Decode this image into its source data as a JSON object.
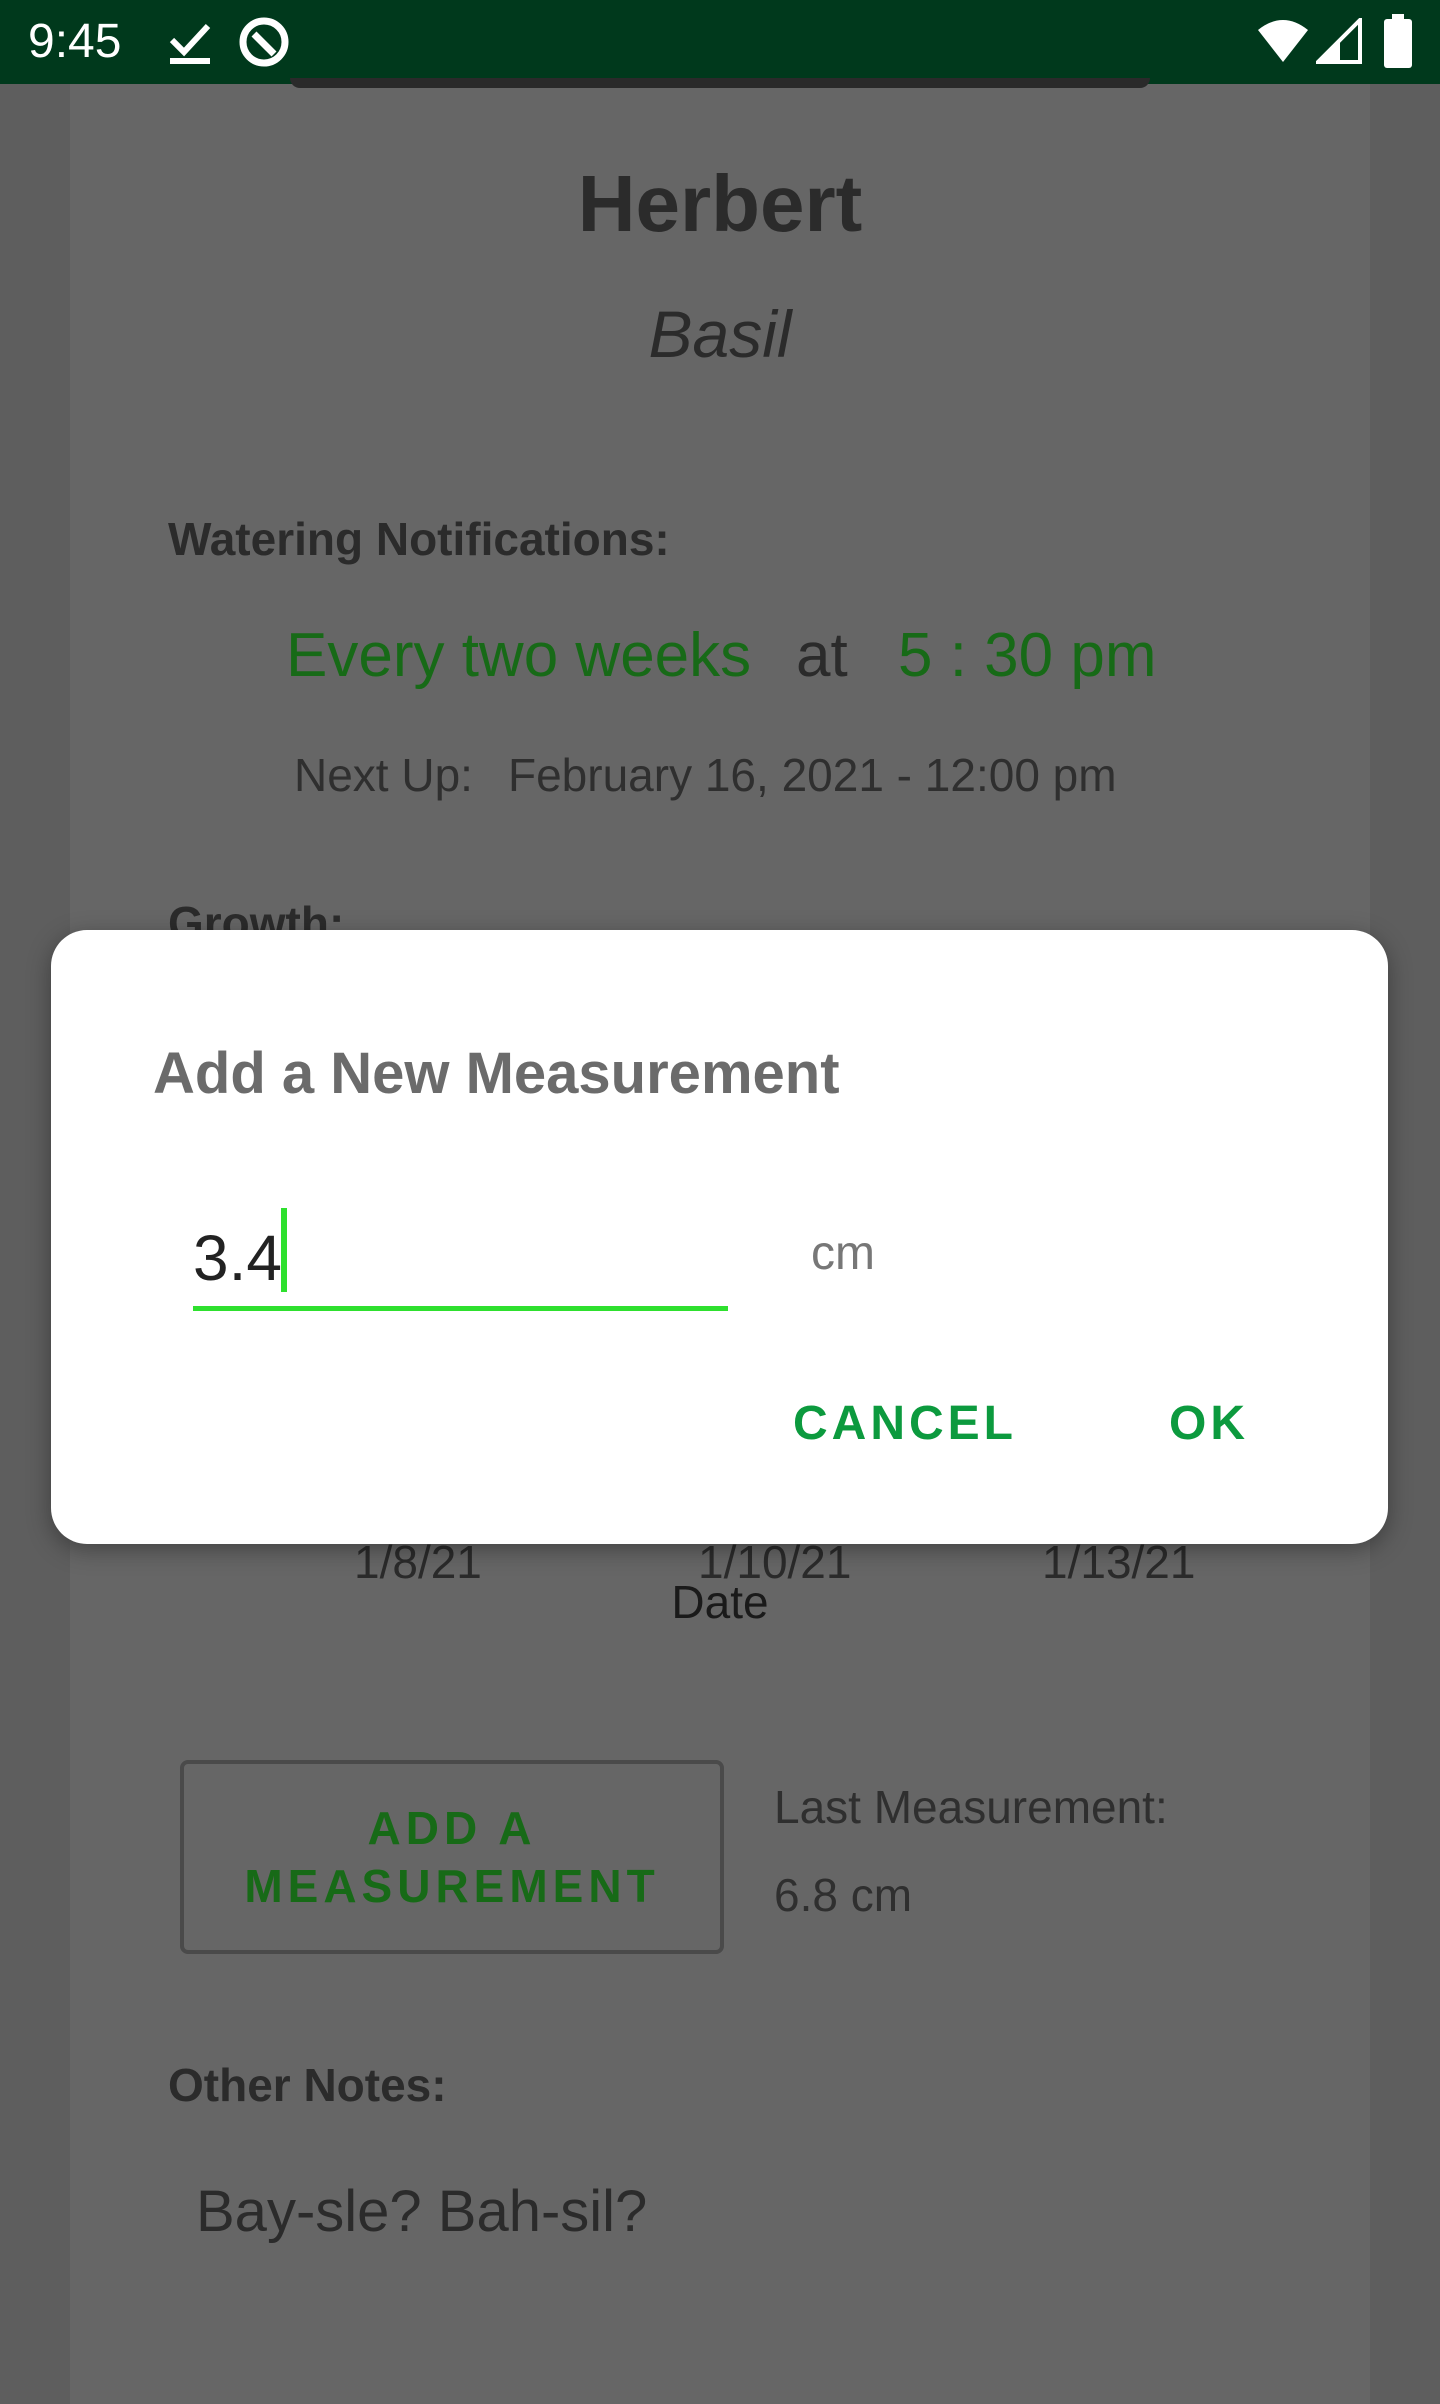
{
  "status_bar": {
    "time": "9:45",
    "icons": [
      "check-download-icon",
      "sync-circle-icon",
      "wifi-icon",
      "cell-signal-icon",
      "battery-icon"
    ]
  },
  "plant": {
    "name": "Herbert",
    "species": "Basil"
  },
  "watering": {
    "label": "Watering Notifications:",
    "frequency": "Every two weeks",
    "at": "at",
    "time": "5 : 30 pm",
    "next_up_label": "Next Up:",
    "next_up_value": "February 16, 2021 - 12:00 pm"
  },
  "growth": {
    "label": "Growth:",
    "chart_ticks": [
      "1/8/21",
      "1/10/21",
      "1/13/21"
    ],
    "chart_xlabel": "Date",
    "add_button_line1": "ADD A",
    "add_button_line2": "MEASUREMENT",
    "last_measurement_label": "Last Measurement:",
    "last_measurement_value": "6.8 cm"
  },
  "notes": {
    "label": "Other Notes:",
    "text": "Bay-sle? Bah-sil?"
  },
  "dialog": {
    "title": "Add a New Measurement",
    "input_value": "3.4",
    "unit": "cm",
    "cancel_label": "CANCEL",
    "ok_label": "OK"
  },
  "colors": {
    "status_bar": "#00391c",
    "accent_green": "#0c9a3e",
    "input_underline": "#2ee02e",
    "dim_overlay": "#5e5e5e"
  }
}
